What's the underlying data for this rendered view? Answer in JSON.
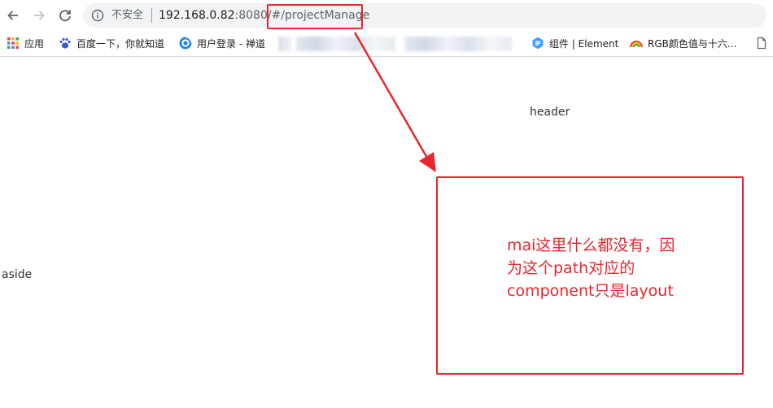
{
  "browser": {
    "security_label": "不安全",
    "url_host": "192.168.0.82",
    "url_rest": ":8080/#/projectManage"
  },
  "bookmarks": {
    "apps": "应用",
    "baidu": "百度一下，你就知道",
    "login": "用户登录 - 禅道",
    "element": "组件 | Element",
    "rgb": "RGB颜色值与十六..."
  },
  "page": {
    "header_text": "header",
    "aside_text": "aside"
  },
  "annotation": {
    "line1": "mai这里什么都没有，因",
    "line2": "为这个path对应的",
    "line3": "component只是layout"
  },
  "colors": {
    "annotation_red": "#e8262d"
  }
}
